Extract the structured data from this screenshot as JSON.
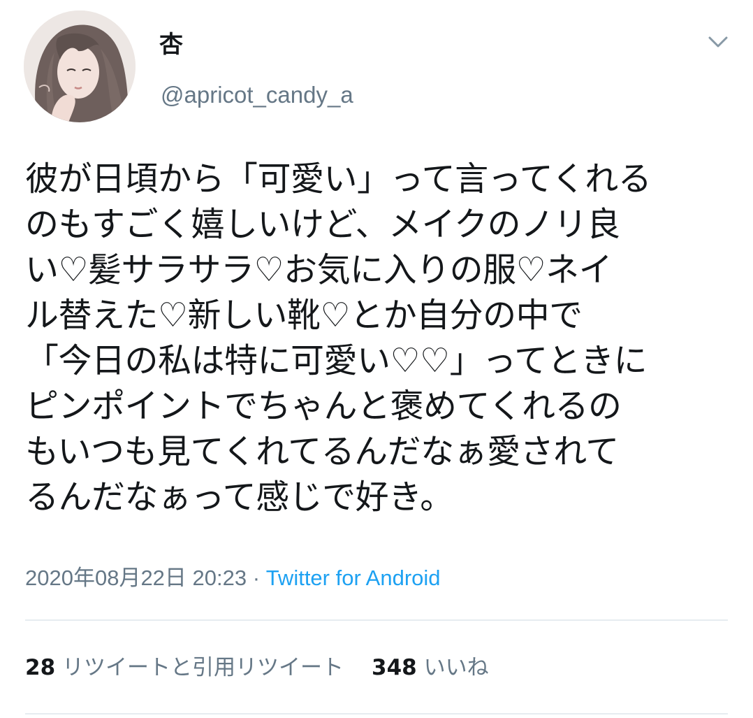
{
  "author": {
    "display_name": "杏",
    "handle": "@apricot_candy_a"
  },
  "icons": {
    "avatar": "avatar-illustration",
    "menu": "chevron-down-icon"
  },
  "tweet": {
    "lines": [
      "彼が日頃から「可愛い」って言ってくれる",
      "のもすごく嬉しいけど、メイクのノリ良",
      "い♡髪サラサラ♡お気に入りの服♡ネイ",
      "ル替えた♡新しい靴♡とか自分の中で",
      "「今日の私は特に可愛い♡♡」ってときに",
      "ピンポイントでちゃんと褒めてくれるの",
      "もいつも見てくれてるんだなぁ愛されて",
      "るんだなぁって感じで好き。"
    ],
    "timestamp": "2020年08月22日 20:23",
    "separator": "·",
    "source": "Twitter for Android"
  },
  "stats": {
    "retweets_count": "28",
    "retweets_label": "リツイートと引用リツイート",
    "likes_count": "348",
    "likes_label": "いいね"
  },
  "colors": {
    "text": "#14171a",
    "secondary": "#657786",
    "link": "#1da1f2",
    "divider": "#e6ecf0"
  }
}
